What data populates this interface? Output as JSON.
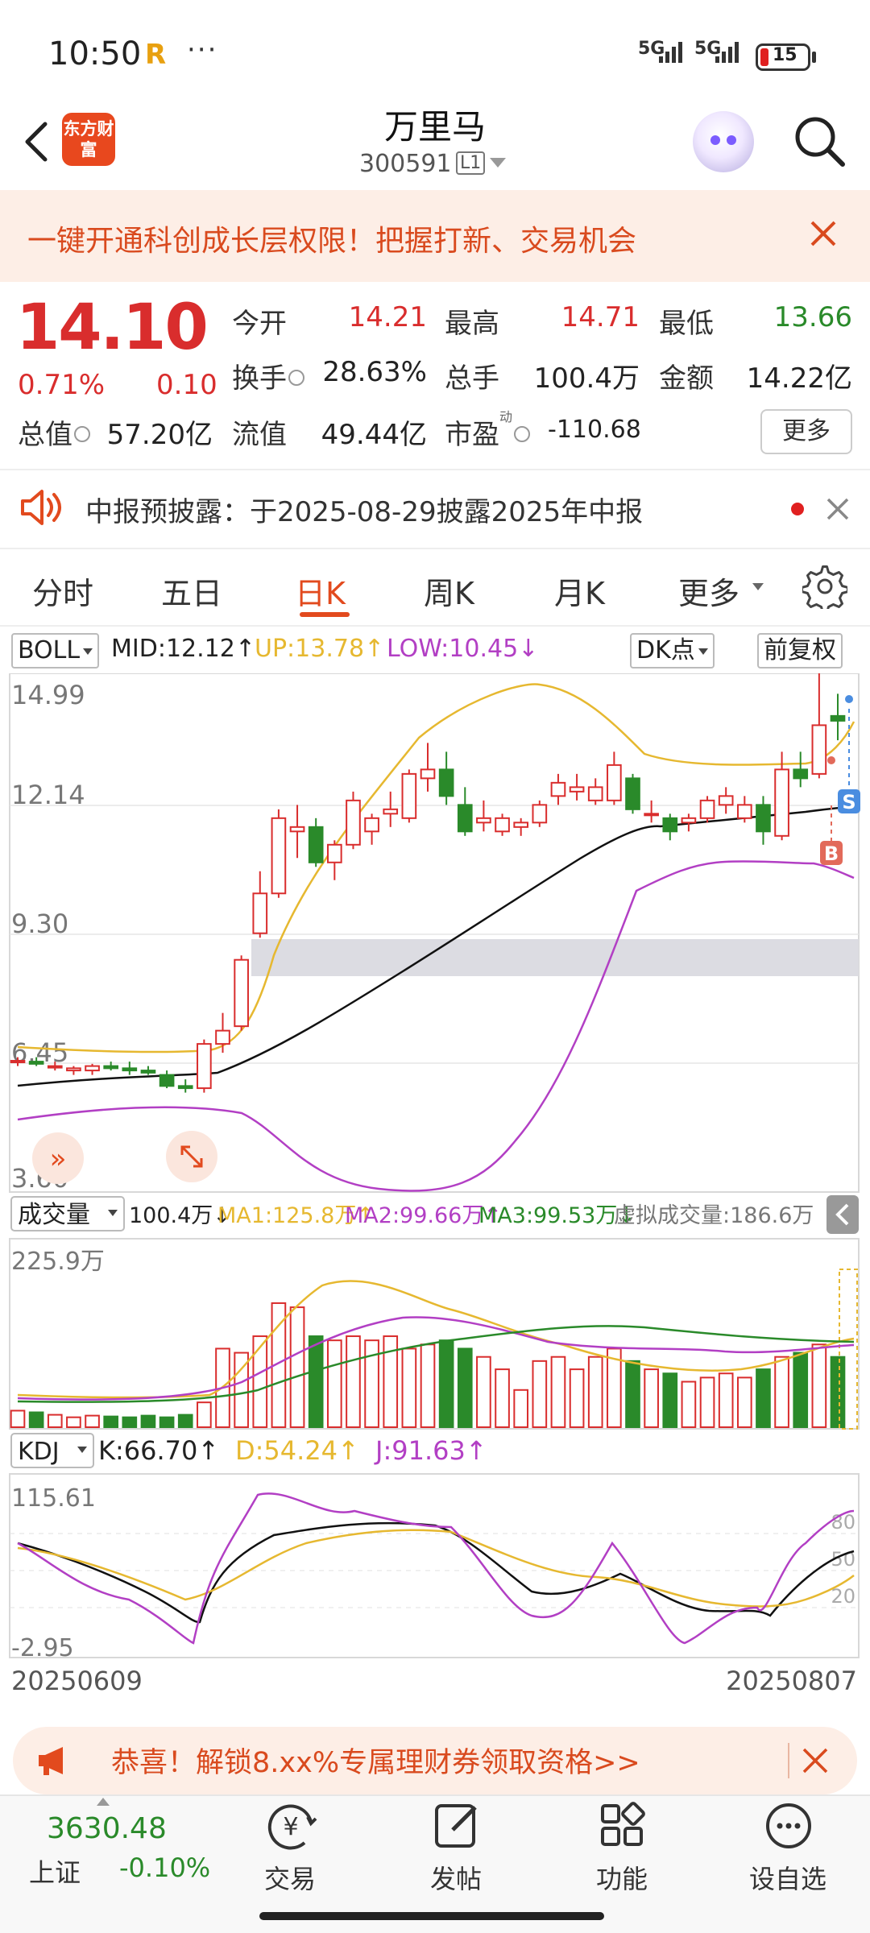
{
  "status_bar": {
    "time": "10:50",
    "signal1": "5G",
    "signal2": "5G",
    "battery": "15"
  },
  "header": {
    "app_logo": "东方财富",
    "stock_name": "万里马",
    "stock_code": "300591",
    "level_badge": "L1"
  },
  "banner": {
    "text": "一键开通科创成长层权限！把握打新、交易机会"
  },
  "quote": {
    "price": "14.10",
    "change_pct": "0.71%",
    "change_abs": "0.10",
    "fields": {
      "open_label": "今开",
      "open": "14.21",
      "high_label": "最高",
      "high": "14.71",
      "low_label": "最低",
      "low": "13.66",
      "turnover_label": "换手",
      "turnover": "28.63%",
      "volume_label": "总手",
      "volume": "100.4万",
      "amount_label": "金额",
      "amount": "14.22亿",
      "mktcap_label": "总值",
      "mktcap": "57.20亿",
      "float_label": "流值",
      "float": "49.44亿",
      "pe_label": "市盈",
      "pe_sup": "动",
      "pe": "-110.68"
    },
    "more_button": "更多"
  },
  "notice": {
    "text": "中报预披露：于2025-08-29披露2025年中报"
  },
  "tabs": [
    "分时",
    "五日",
    "日K",
    "周K",
    "月K",
    "更多"
  ],
  "boll": {
    "selector": "BOLL",
    "mid": "MID:12.12↑",
    "up": "UP:13.78↑",
    "low": "LOW:10.45↓",
    "dk_button": "DK点",
    "adjust_button": "前复权",
    "y_labels": [
      "14.99",
      "12.14",
      "9.30",
      "6.45",
      "3.60"
    ],
    "buy_marker": "B",
    "sell_marker": "S"
  },
  "volume": {
    "selector": "成交量",
    "value": "100.4万↓",
    "ma1": "MA1:125.8万↑",
    "ma2": "MA2:99.66万↑",
    "ma3": "MA3:99.53万↓",
    "virtual": "虚拟成交量:186.6万",
    "y_label": "225.9万"
  },
  "kdj": {
    "selector": "KDJ",
    "k": "K:66.70↑",
    "d": "D:54.24↑",
    "j": "J:91.63↑",
    "y_top": "115.61",
    "y_bottom": "-2.95",
    "levels": [
      "80",
      "50",
      "20"
    ]
  },
  "dates": {
    "start": "20250609",
    "end": "20250807"
  },
  "promo": {
    "text": "恭喜！解锁8.xx%专属理财券领取资格>>"
  },
  "bottom_bar": {
    "index_value": "3630.48",
    "index_name": "上证",
    "index_change": "-0.10%",
    "nav": [
      "交易",
      "发帖",
      "功能",
      "设自选"
    ]
  },
  "colors": {
    "accent": "#e24a1e",
    "up": "#d92d2d",
    "down": "#2a8a2a",
    "mid_line": "#111111",
    "up_line": "#e6b830",
    "low_line": "#b23fc4"
  },
  "chart_data": {
    "type": "candlestick",
    "candles": [
      {
        "o": 6.4,
        "h": 6.5,
        "l": 6.3,
        "c": 6.42
      },
      {
        "o": 6.4,
        "h": 6.5,
        "l": 6.3,
        "c": 6.35
      },
      {
        "o": 6.3,
        "h": 6.4,
        "l": 6.2,
        "c": 6.3
      },
      {
        "o": 6.2,
        "h": 6.3,
        "l": 6.1,
        "c": 6.25
      },
      {
        "o": 6.2,
        "h": 6.35,
        "l": 6.1,
        "c": 6.3
      },
      {
        "o": 6.3,
        "h": 6.4,
        "l": 6.2,
        "c": 6.25
      },
      {
        "o": 6.25,
        "h": 6.4,
        "l": 6.1,
        "c": 6.2
      },
      {
        "o": 6.2,
        "h": 6.3,
        "l": 6.1,
        "c": 6.15
      },
      {
        "o": 6.1,
        "h": 6.2,
        "l": 5.8,
        "c": 5.85
      },
      {
        "o": 5.85,
        "h": 6.0,
        "l": 5.7,
        "c": 5.8
      },
      {
        "o": 5.8,
        "h": 6.9,
        "l": 5.7,
        "c": 6.8
      },
      {
        "o": 6.8,
        "h": 7.5,
        "l": 6.6,
        "c": 7.1
      },
      {
        "o": 7.2,
        "h": 8.8,
        "l": 7.1,
        "c": 8.7
      },
      {
        "o": 9.3,
        "h": 10.7,
        "l": 9.2,
        "c": 10.2
      },
      {
        "o": 10.2,
        "h": 12.1,
        "l": 10.1,
        "c": 11.9
      },
      {
        "o": 11.6,
        "h": 12.2,
        "l": 11.0,
        "c": 11.7
      },
      {
        "o": 11.7,
        "h": 11.9,
        "l": 10.8,
        "c": 10.9
      },
      {
        "o": 10.9,
        "h": 11.4,
        "l": 10.5,
        "c": 11.3
      },
      {
        "o": 11.3,
        "h": 12.5,
        "l": 11.2,
        "c": 12.3
      },
      {
        "o": 11.6,
        "h": 12.0,
        "l": 11.3,
        "c": 11.9
      },
      {
        "o": 12.0,
        "h": 12.5,
        "l": 11.7,
        "c": 12.1
      },
      {
        "o": 11.9,
        "h": 13.0,
        "l": 11.8,
        "c": 12.9
      },
      {
        "o": 12.8,
        "h": 13.6,
        "l": 12.5,
        "c": 13.0
      },
      {
        "o": 13.0,
        "h": 13.4,
        "l": 12.2,
        "c": 12.4
      },
      {
        "o": 12.2,
        "h": 12.6,
        "l": 11.5,
        "c": 11.6
      },
      {
        "o": 11.8,
        "h": 12.3,
        "l": 11.6,
        "c": 11.9
      },
      {
        "o": 11.6,
        "h": 12.0,
        "l": 11.5,
        "c": 11.9
      },
      {
        "o": 11.7,
        "h": 11.9,
        "l": 11.5,
        "c": 11.8
      },
      {
        "o": 11.8,
        "h": 12.3,
        "l": 11.7,
        "c": 12.2
      },
      {
        "o": 12.4,
        "h": 12.9,
        "l": 12.2,
        "c": 12.7
      },
      {
        "o": 12.5,
        "h": 12.9,
        "l": 12.3,
        "c": 12.6
      },
      {
        "o": 12.3,
        "h": 12.8,
        "l": 12.2,
        "c": 12.6
      },
      {
        "o": 12.3,
        "h": 13.4,
        "l": 12.2,
        "c": 13.1
      },
      {
        "o": 12.8,
        "h": 12.9,
        "l": 12.0,
        "c": 12.1
      },
      {
        "o": 12.0,
        "h": 12.3,
        "l": 11.8,
        "c": 12.0
      },
      {
        "o": 11.9,
        "h": 12.0,
        "l": 11.4,
        "c": 11.6
      },
      {
        "o": 11.8,
        "h": 12.0,
        "l": 11.6,
        "c": 11.9
      },
      {
        "o": 11.9,
        "h": 12.4,
        "l": 11.8,
        "c": 12.3
      },
      {
        "o": 12.2,
        "h": 12.6,
        "l": 12.0,
        "c": 12.4
      },
      {
        "o": 11.9,
        "h": 12.4,
        "l": 11.8,
        "c": 12.2
      },
      {
        "o": 12.2,
        "h": 12.4,
        "l": 11.3,
        "c": 11.6
      },
      {
        "o": 11.5,
        "h": 13.4,
        "l": 11.4,
        "c": 13.0
      },
      {
        "o": 13.0,
        "h": 13.4,
        "l": 12.6,
        "c": 12.8
      },
      {
        "o": 12.9,
        "h": 15.2,
        "l": 12.8,
        "c": 14.0
      },
      {
        "o": 14.21,
        "h": 14.71,
        "l": 13.66,
        "c": 14.1
      }
    ],
    "volume": [
      20,
      18,
      15,
      12,
      14,
      13,
      12,
      14,
      12,
      15,
      30,
      95,
      90,
      110,
      150,
      145,
      110,
      105,
      110,
      105,
      110,
      95,
      100,
      105,
      95,
      85,
      70,
      45,
      80,
      85,
      70,
      85,
      95,
      80,
      70,
      65,
      55,
      60,
      65,
      60,
      70,
      85,
      90,
      100,
      85
    ],
    "ylim": [
      3.6,
      14.99
    ],
    "volume_max": 225.9,
    "kdj_ylim": [
      -2.95,
      115.61
    ]
  }
}
